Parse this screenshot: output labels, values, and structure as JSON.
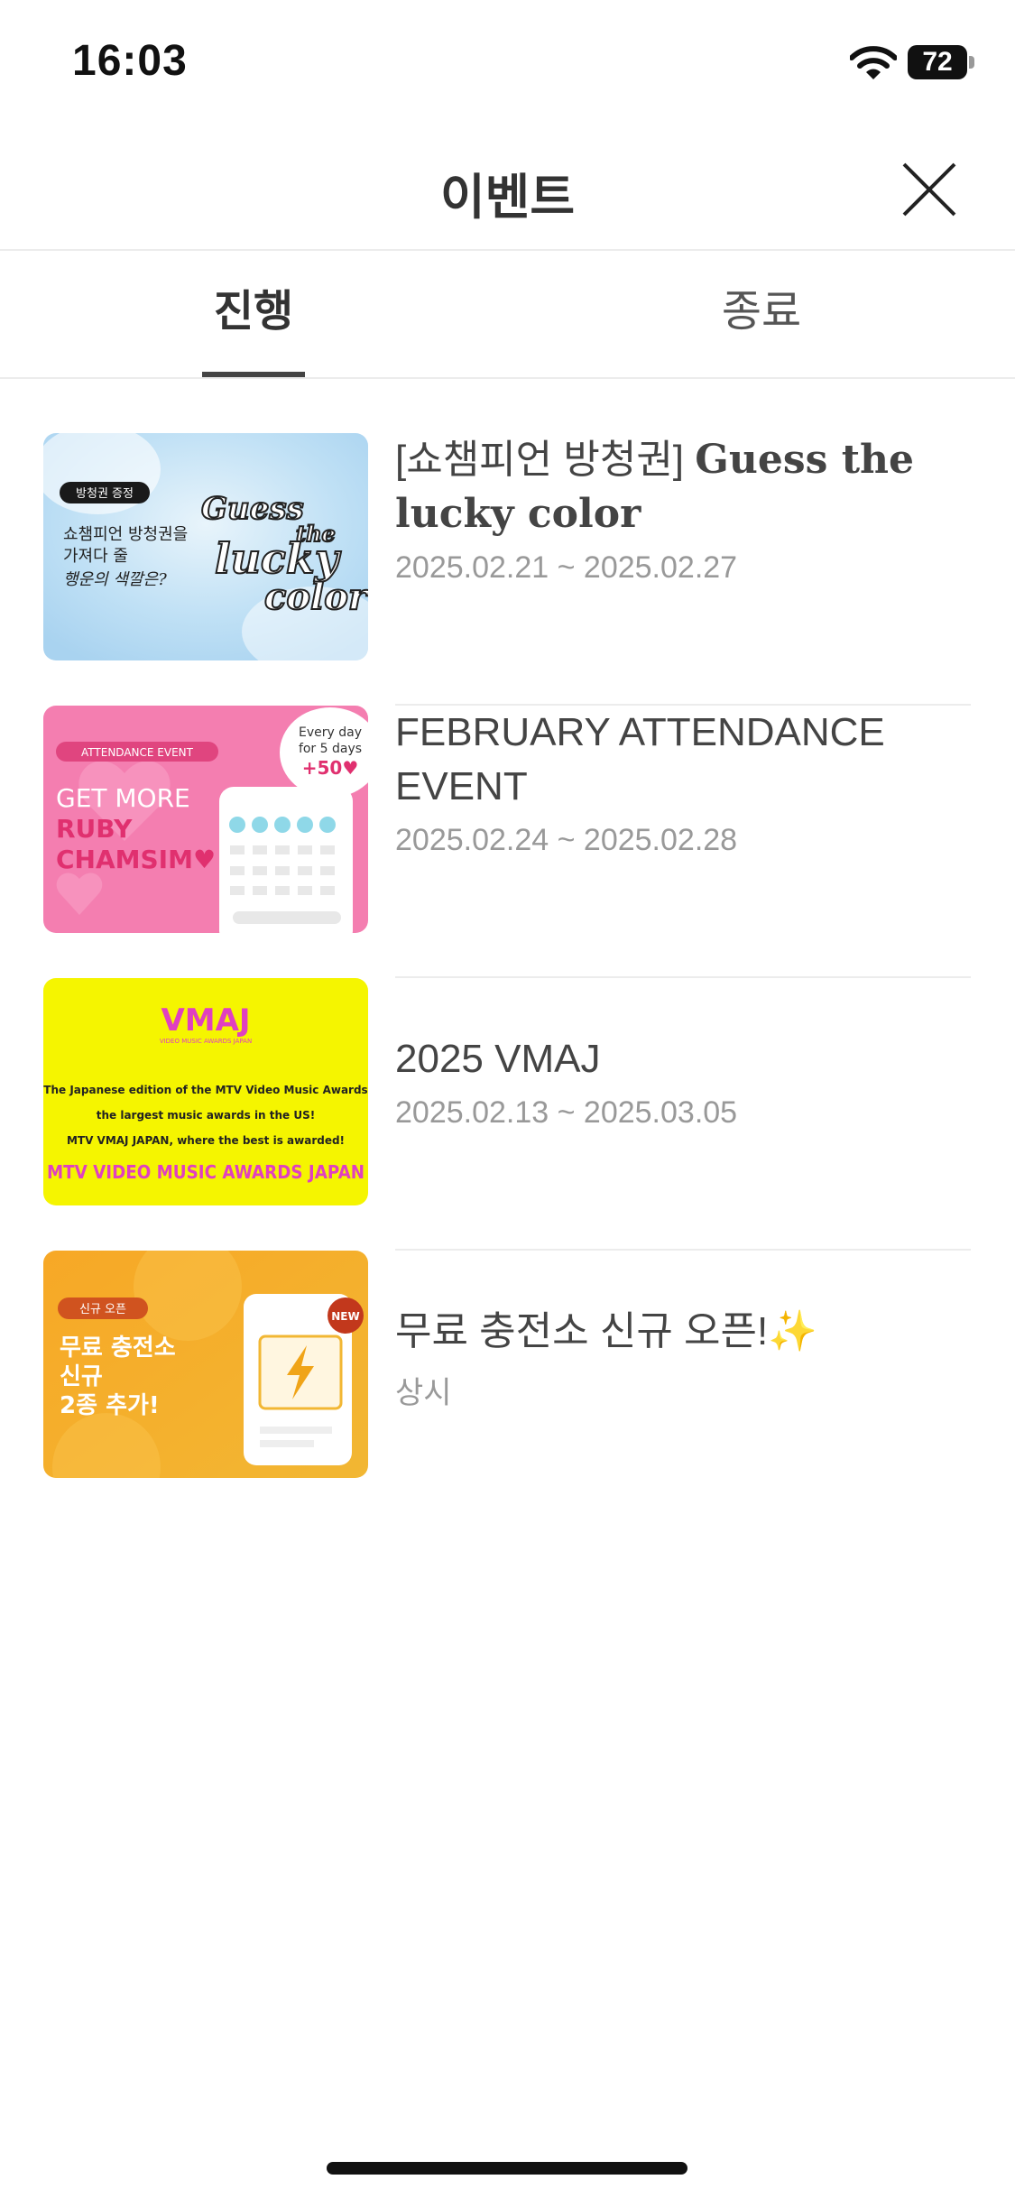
{
  "status": {
    "time": "16:03",
    "battery": "72"
  },
  "header": {
    "title": "이벤트"
  },
  "tabs": {
    "active": "진행",
    "inactive": "종료"
  },
  "events": [
    {
      "title_prefix": "[쇼챔피언 방청권] ",
      "title_serif": "Guess the lucky color",
      "date": "2025.02.21 ~ 2025.02.27",
      "thumb": {
        "badge": "방청권 증정",
        "line1": "쇼챔피언 방청권을",
        "line2": "가져다 줄",
        "line3": "행운의 색깔은?",
        "logo_line1": "Guess",
        "logo_line2": "the",
        "logo_line3": "lucky",
        "logo_line4": "color"
      }
    },
    {
      "title": "FEBRUARY ATTENDANCE EVENT",
      "date": "2025.02.24 ~ 2025.02.28",
      "thumb": {
        "badge": "ATTENDANCE EVENT",
        "line1": "GET MORE",
        "line2": "RUBY",
        "line3": "CHAMSIM♥",
        "bubble1": "Every day",
        "bubble2": "for 5 days",
        "bubble3": "+50♥"
      }
    },
    {
      "title": "2025 VMAJ",
      "date": "2025.02.13 ~ 2025.03.05",
      "thumb": {
        "logo": "VMAJ",
        "logo_sub": "VIDEO MUSIC AWARDS JAPAN",
        "line1": "The Japanese edition of the MTV Video Music Awards",
        "line2": "the largest music awards in the US!",
        "line3": "MTV VMAJ JAPAN, where the best is awarded!",
        "footer": "MTV VIDEO MUSIC AWARDS JAPAN"
      }
    },
    {
      "title": "무료 충전소 신규 오픈!",
      "title_emoji": "✨",
      "date": "상시",
      "thumb": {
        "badge": "신규 오픈",
        "line1": "무료 충전소",
        "line2": "신규",
        "line3": "2종 추가!",
        "new": "NEW"
      }
    }
  ],
  "colors": {
    "accent": "#444444",
    "divider": "#ececec",
    "date": "#999999",
    "vmaj_yellow": "#f5f500",
    "vmaj_pink": "#e040c0"
  }
}
